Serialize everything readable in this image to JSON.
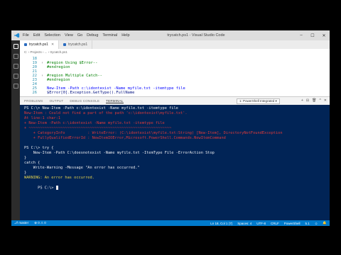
{
  "window": {
    "title": "trycatch.ps1 - Visual Studio Code",
    "menu": [
      "File",
      "Edit",
      "Selection",
      "View",
      "Go",
      "Debug",
      "Terminal",
      "Help"
    ]
  },
  "tabs": [
    {
      "label": "trycatch.ps1"
    },
    {
      "label": "trycatch.ps1"
    }
  ],
  "breadcrumb": "C: › Projects › ... › trycatch.ps1",
  "editor": {
    "lines": [
      {
        "num": "18",
        "text": ""
      },
      {
        "num": "19",
        "text": "#region Using $Error--"
      },
      {
        "num": "20",
        "text": "#endregion"
      },
      {
        "num": "21",
        "text": ""
      },
      {
        "num": "22",
        "text": "#region Multiple Catch--"
      },
      {
        "num": "23",
        "text": "#endregion"
      },
      {
        "num": "24",
        "text": ""
      },
      {
        "num": "25",
        "text": "New-Item -Path c:\\idontexist -Name myfile.txt -itemtype file"
      },
      {
        "num": "26",
        "text": "$Error[0].Exception.GetType().FullName"
      }
    ]
  },
  "panel": {
    "tabs": [
      "PROBLEMS",
      "OUTPUT",
      "DEBUG CONSOLE",
      "TERMINAL"
    ],
    "active_tab": "TERMINAL",
    "terminal_select": "1: PowerShell Integrated ▾",
    "actions": [
      "+",
      "⊟",
      "🗑",
      "^",
      "✕"
    ]
  },
  "terminal": {
    "lines": [
      {
        "text": "PS C:\\> New-Item -Path c:\\idontexist -Name myfile.txt -itemtype file",
        "color": "white"
      },
      {
        "text": "New-Item : Could not find a part of the path 'c:\\idontexist\\myfile.txt'.",
        "color": "red"
      },
      {
        "text": "At line:1 char:1",
        "color": "red"
      },
      {
        "text": "+ New-Item -Path c:\\idontexist -Name myfile.txt -itemtype file",
        "color": "red"
      },
      {
        "text": "+ ~~~~~~~~~~~~~~~~~~~~~~~~~~~~~~~~~~~~~~~~~~~~~~~~~~~~~~~~~~~~~~~",
        "color": "red"
      },
      {
        "text": "    + CategoryInfo          : WriteError: (C:\\idontexist\\myfile.txt:String) [New-Item], DirectoryNotFoundException",
        "color": "red"
      },
      {
        "text": "    + FullyQualifiedErrorId : NewItemIOError,Microsoft.PowerShell.Commands.NewItemCommand",
        "color": "red"
      },
      {
        "text": "",
        "color": "white"
      },
      {
        "text": "PS C:\\> try {",
        "color": "white"
      },
      {
        "text": "    New-Item -Path C:\\doesnotexist -Name myfile.txt -ItemType File -ErrorAction Stop",
        "color": "white"
      },
      {
        "text": "}",
        "color": "white"
      },
      {
        "text": "catch {",
        "color": "white"
      },
      {
        "text": "    Write-Warning -Message \"An error has occurred.\"",
        "color": "white"
      },
      {
        "text": "}",
        "color": "white"
      },
      {
        "text": "WARNING: An error has occurred.",
        "color": "yellow"
      },
      {
        "text": "PS C:\\> ",
        "color": "white",
        "cursor": true
      }
    ]
  },
  "statusbar": {
    "left": [
      "⎇ master",
      "⊗ 0 ⚠ 0"
    ],
    "right": [
      "Ln 18, Col 1 (7)",
      "Spaces: 4",
      "UTF-8",
      "CRLF",
      "PowerShell",
      "5.1",
      "☺",
      "🔔"
    ]
  },
  "colors": {
    "terminal_bg": "#012456",
    "statusbar_bg": "#007acc",
    "error": "#e13a3a",
    "warning": "#e8d44d"
  }
}
